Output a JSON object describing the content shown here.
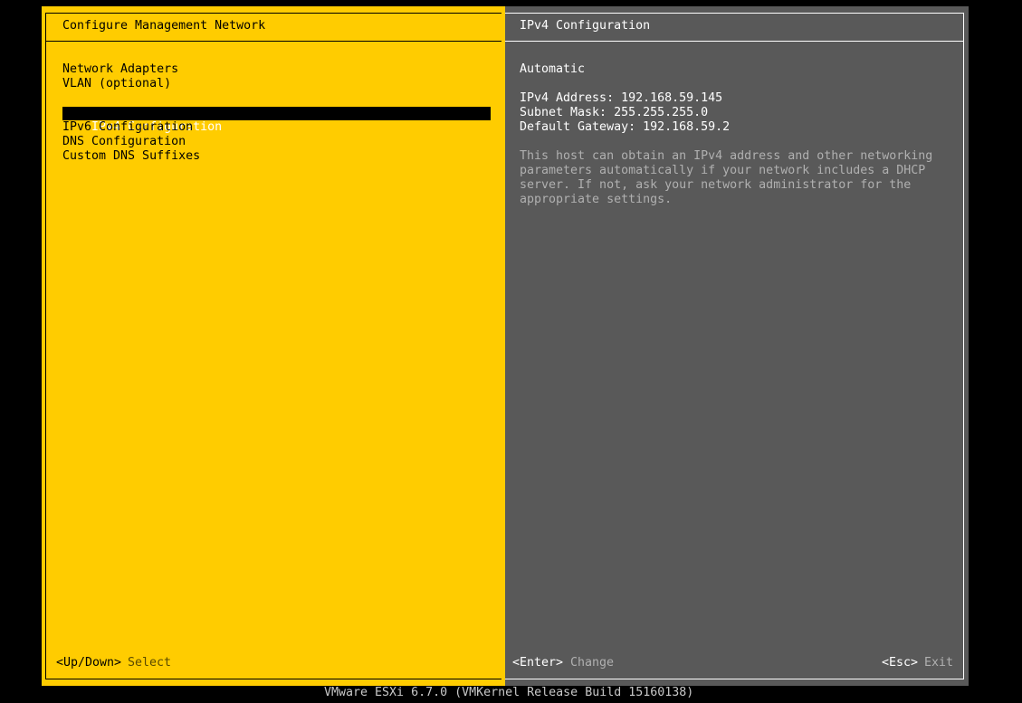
{
  "left_panel": {
    "title": "Configure Management Network",
    "menu_items": [
      {
        "label": "Network Adapters"
      },
      {
        "label": "VLAN (optional)"
      },
      {
        "label": "IPv4 Configuration"
      },
      {
        "label": "IPv6 Configuration"
      },
      {
        "label": "DNS Configuration"
      },
      {
        "label": "Custom DNS Suffixes"
      }
    ],
    "selected_index": 2,
    "hint_key": "<Up/Down>",
    "hint_action": "Select"
  },
  "right_panel": {
    "title": "IPv4 Configuration",
    "mode": "Automatic",
    "ipv4_address_line": "IPv4 Address: 192.168.59.145",
    "subnet_mask_line": "Subnet Mask: 255.255.255.0",
    "default_gateway_line": "Default Gateway: 192.168.59.2",
    "description_lines": [
      "This host can obtain an IPv4 address and other networking",
      "parameters automatically if your network includes a DHCP",
      "server. If not, ask your network administrator for the",
      "appropriate settings."
    ],
    "enter_key": "<Enter>",
    "enter_action": "Change",
    "esc_key": "<Esc>",
    "esc_action": "Exit"
  },
  "footer": {
    "version_text": "VMware ESXi 6.7.0 (VMKernel Release Build 15160138)"
  },
  "colors": {
    "left_background": "#ffcc00",
    "right_background": "#595959",
    "selection_background": "#000000",
    "screen_background": "#000000"
  }
}
